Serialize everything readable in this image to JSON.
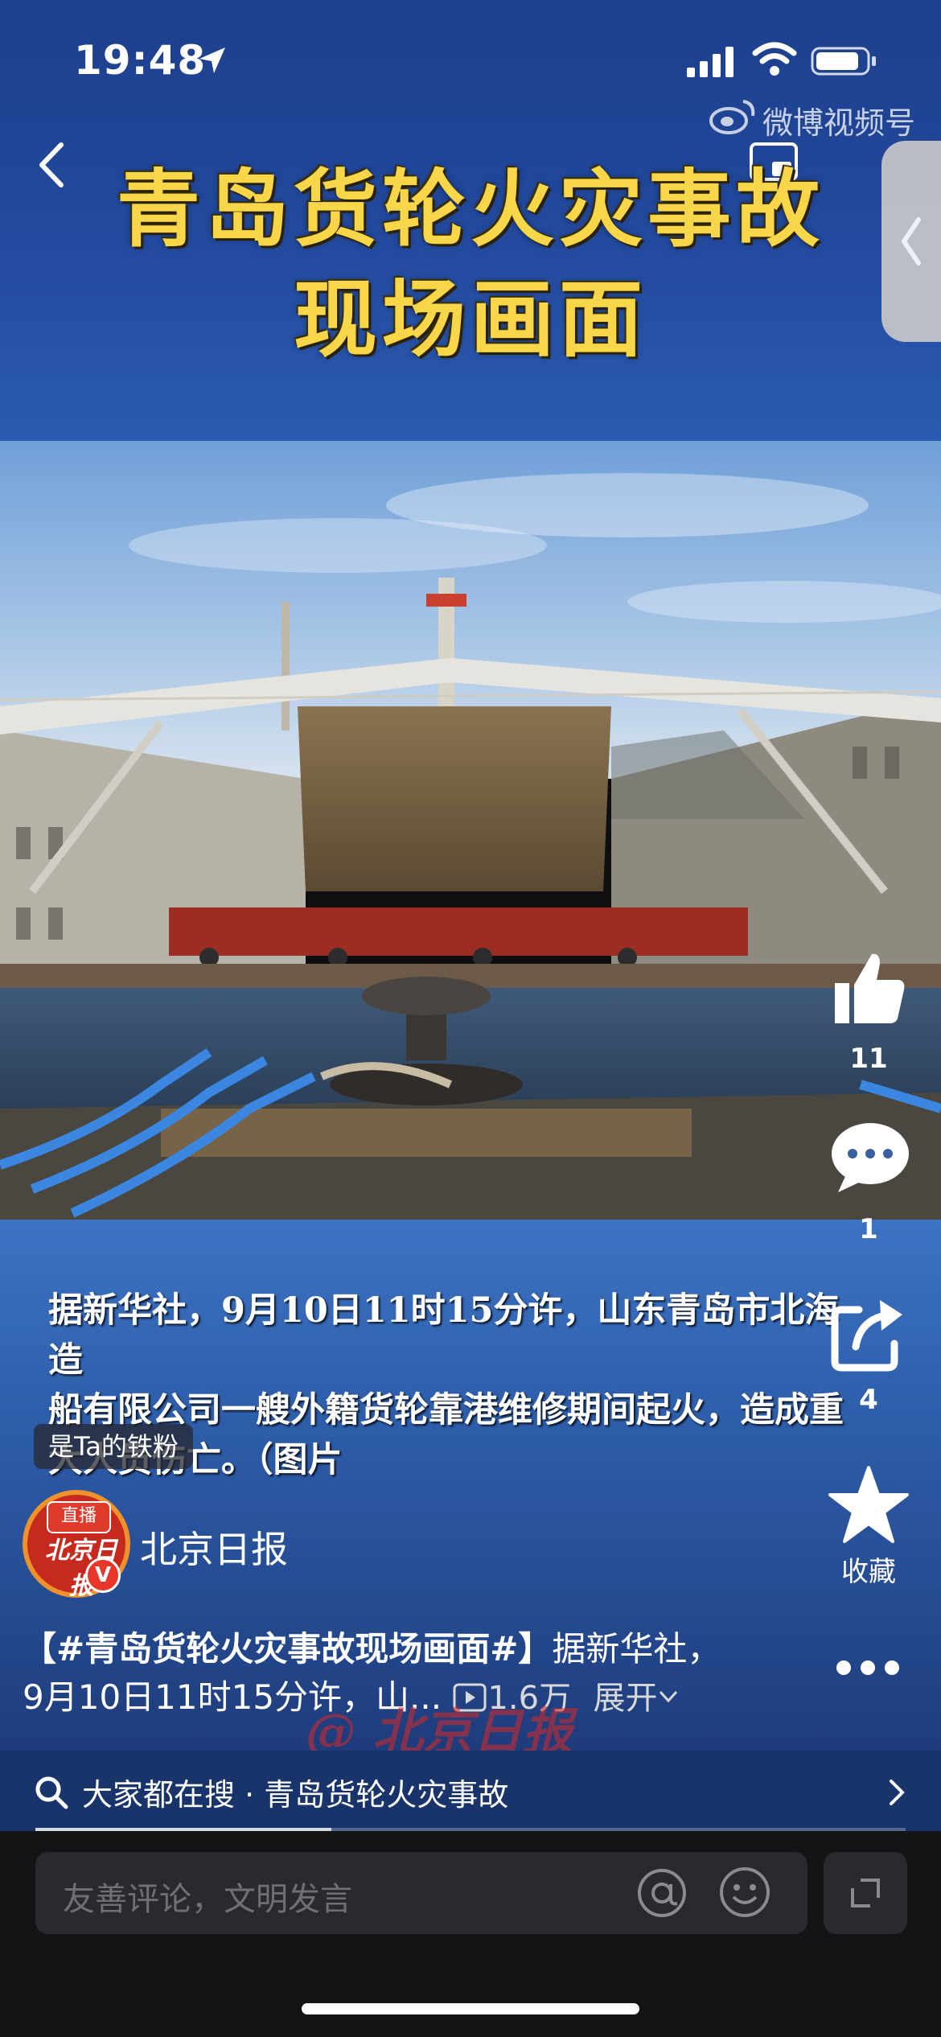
{
  "status_bar": {
    "time": "19:48"
  },
  "video": {
    "headline_line1": "青岛货轮火灾事故",
    "headline_line2": "现场画面",
    "watermark": "微博视频号",
    "subtitle_lines": [
      "据新华社，9月10日11时15分许，山东青岛市北海造",
      "船有限公司一艘外籍货轮靠港维修期间起火，造成重",
      "大人员伤亡。（图片"
    ],
    "progress": 0.34
  },
  "author": {
    "fan_badge": "是Ta的铁粉",
    "live_tag": "直播",
    "avatar_text": "北京日报",
    "verified": "V",
    "name": "北京日报"
  },
  "post": {
    "hashtag_title": "【#青岛货轮火灾事故现场画面#】",
    "text_part1": "据新华社，",
    "text_part2": "9月10日11时15分许，山...",
    "play_count": "1.6万",
    "expand_label": "展开"
  },
  "watermark_bottom": "@ 北京日报",
  "actions": {
    "like_count": "11",
    "comment_count": "1",
    "share_count": "4",
    "favorite_label": "收藏"
  },
  "search_suggestion": {
    "prefix": "大家都在搜",
    "separator": "·",
    "query": "青岛货轮火灾事故"
  },
  "comment_bar": {
    "placeholder": "友善评论，文明发言"
  },
  "colors": {
    "headline": "#f7d64a",
    "title_bg": "#234a9e",
    "caption_bg": "#2d5ca8"
  }
}
